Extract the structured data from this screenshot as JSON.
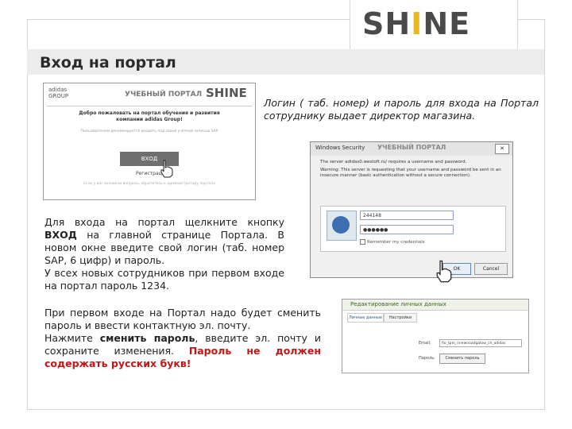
{
  "header": {
    "logo_left": "SH",
    "logo_i": "I",
    "logo_right": "NE",
    "title": "Вход на портал"
  },
  "screenshot_portal": {
    "brand_line1": "adidas",
    "brand_line2": "GROUP",
    "portal_title": "УЧЕБНЫЙ ПОРТАЛ",
    "logo": "SHINE",
    "welcome": "Добро пожаловать на портал обучения и развития компании adidas Group!",
    "small_text": "Пользователям рекомендуется входить под своей учётной записью SAP",
    "login_button": "ВХОД",
    "link": "Регистрация",
    "footer": "Если у вас возникли вопросы, обратитесь к администратору портала"
  },
  "text_blocks": {
    "t1": "Логин ( таб. номер) и пароль для входа на Портал сотруднику выдает директор магазина.",
    "t2_a": "Для входа на портал щелкните кнопку ",
    "t2_bold": "ВХОД",
    "t2_b": " на главной странице Портала. В новом окне введите свой логин (таб. номер SAP, 6 цифр) и пароль.",
    "t2_c": "У всех новых сотрудников при первом входе на портал пароль 1234.",
    "t3_a": "При первом входе на Портал надо будет сменить пароль и ввести контактную эл. почту.",
    "t3_b1": "Нажмите ",
    "t3_bold": "сменить пароль",
    "t3_b2": ", введите эл. почту и сохраните изменения. ",
    "t3_red": "Пароль не должен содержать русских букв!"
  },
  "screenshot_security": {
    "window_title": "Windows Security",
    "portal_title": "УЧЕБНЫЙ ПОРТАЛ",
    "close": "✕",
    "message": "The server adidas0.westoft.ru/ requires a username and password.",
    "warning": "Warning: This server is requesting that your username and password be sent in an insecure manner (basic authentication without a secure connection).",
    "username_value": "244148",
    "password_value": "●●●●●●",
    "remember": "Remember my credentials",
    "ok": "OK",
    "cancel": "Cancel"
  },
  "screenshot_edit": {
    "title": "Редактирование личных данных",
    "tab1": "Личные данные",
    "tab2": "Настройки",
    "email_label": "Email:",
    "email_value": "fio_tpm_nnewnoadgalow_ch_adidas",
    "password_label": "Пароль:",
    "change_password": "Сменить пароль"
  }
}
